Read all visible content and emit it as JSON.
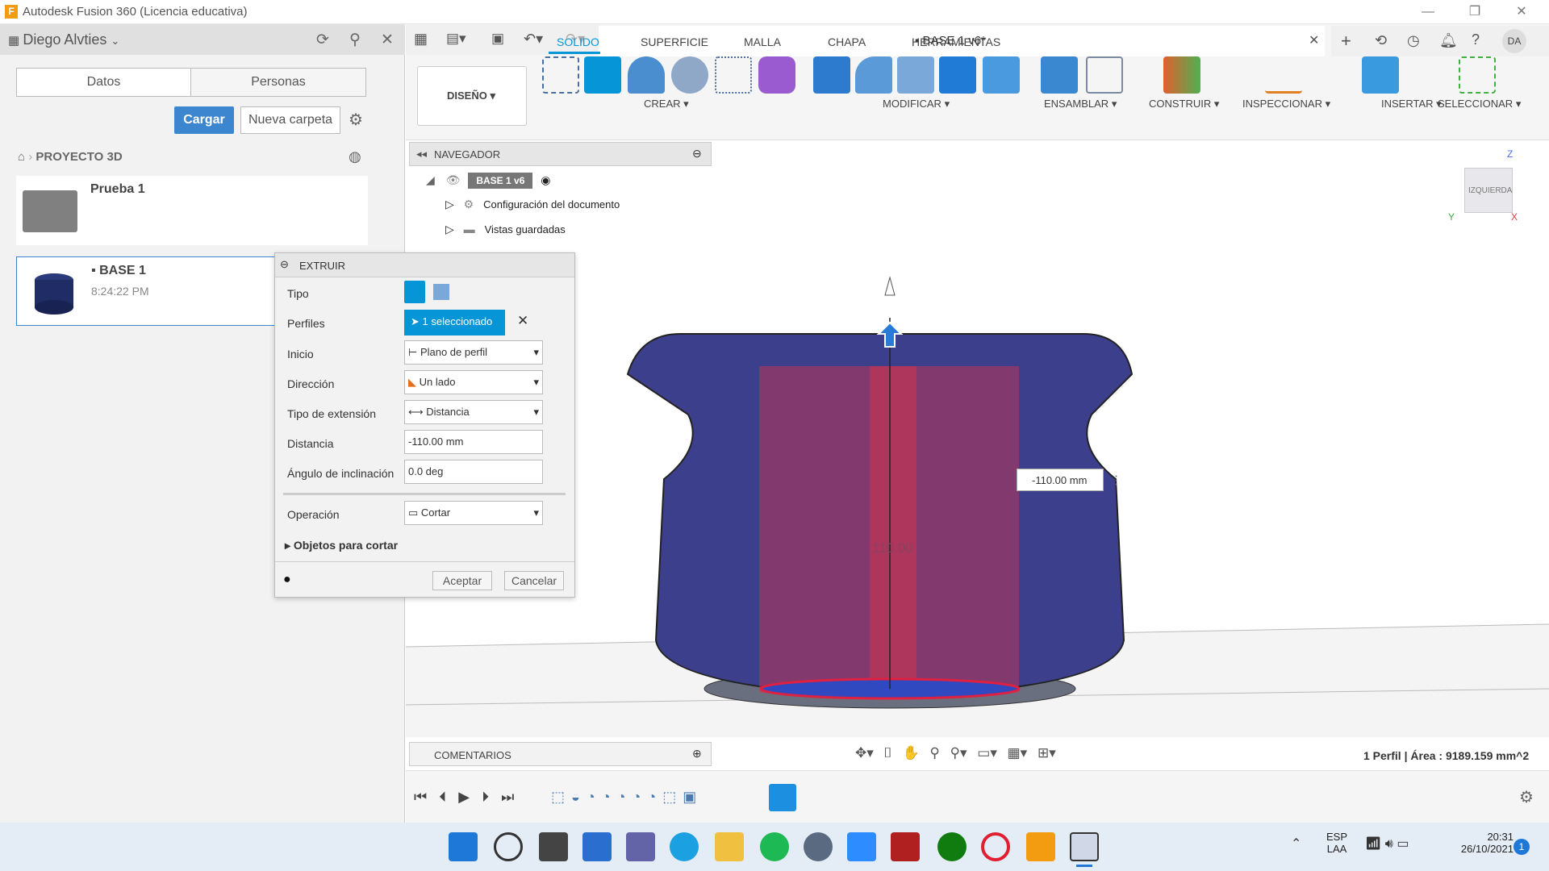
{
  "titlebar": {
    "title": "Autodesk Fusion 360 (Licencia educativa)"
  },
  "left_panel": {
    "user": "Diego Alvties",
    "tabs": [
      "Datos",
      "Personas"
    ],
    "upload_button": "Cargar",
    "new_folder_button": "Nueva carpeta",
    "breadcrumb": "PROYECTO 3D",
    "items": [
      {
        "name": "Prueba 1",
        "sub": ""
      },
      {
        "name": "BASE 1",
        "sub": "8:24:22 PM"
      }
    ]
  },
  "document": {
    "tab_title": "BASE 1 v6*",
    "user_initials": "DA"
  },
  "toolbar": {
    "workspace": "DISEÑO",
    "tabs": [
      "SOLIDO",
      "SUPERFICIE",
      "MALLA",
      "CHAPA",
      "HERRAMIENTAS"
    ],
    "groups": [
      "CREAR",
      "MODIFICAR",
      "ENSAMBLAR",
      "CONSTRUIR",
      "INSPECCIONAR",
      "INSERTAR",
      "SELECCIONAR"
    ]
  },
  "browser": {
    "title": "NAVEGADOR",
    "root": "BASE 1 v6",
    "items": [
      "Configuración del documento",
      "Vistas guardadas"
    ]
  },
  "extrude": {
    "title": "EXTRUIR",
    "labels": {
      "tipo": "Tipo",
      "perfiles": "Perfiles",
      "inicio": "Inicio",
      "direccion": "Dirección",
      "tipo_extension": "Tipo de extensión",
      "distancia": "Distancia",
      "angulo": "Ángulo de inclinación",
      "operacion": "Operación",
      "objetos": "Objetos para cortar"
    },
    "values": {
      "perfiles": "1 seleccionado",
      "inicio": "Plano de perfil",
      "direccion": "Un lado",
      "tipo_extension": "Distancia",
      "distancia": "-110.00 mm",
      "angulo": "0.0 deg",
      "operacion": "Cortar"
    },
    "accept": "Aceptar",
    "cancel": "Cancelar"
  },
  "viewport": {
    "dimension_input": "-110.00 mm",
    "dimension_label": "110.00",
    "viewcube_label": "IZQUIERDA",
    "axis_z": "Z",
    "axis_y": "Y",
    "axis_x": "X"
  },
  "comments": {
    "title": "COMENTARIOS"
  },
  "status": {
    "text": "1 Perfil | Área : 9189.159 mm^2"
  },
  "taskbar": {
    "lang1": "ESP",
    "lang2": "LAA",
    "time": "20:31",
    "date": "26/10/2021",
    "notif": "1"
  },
  "colors": {
    "accent": "#0696d7",
    "body": "#3b3f8c",
    "cut": "#d9334a"
  }
}
